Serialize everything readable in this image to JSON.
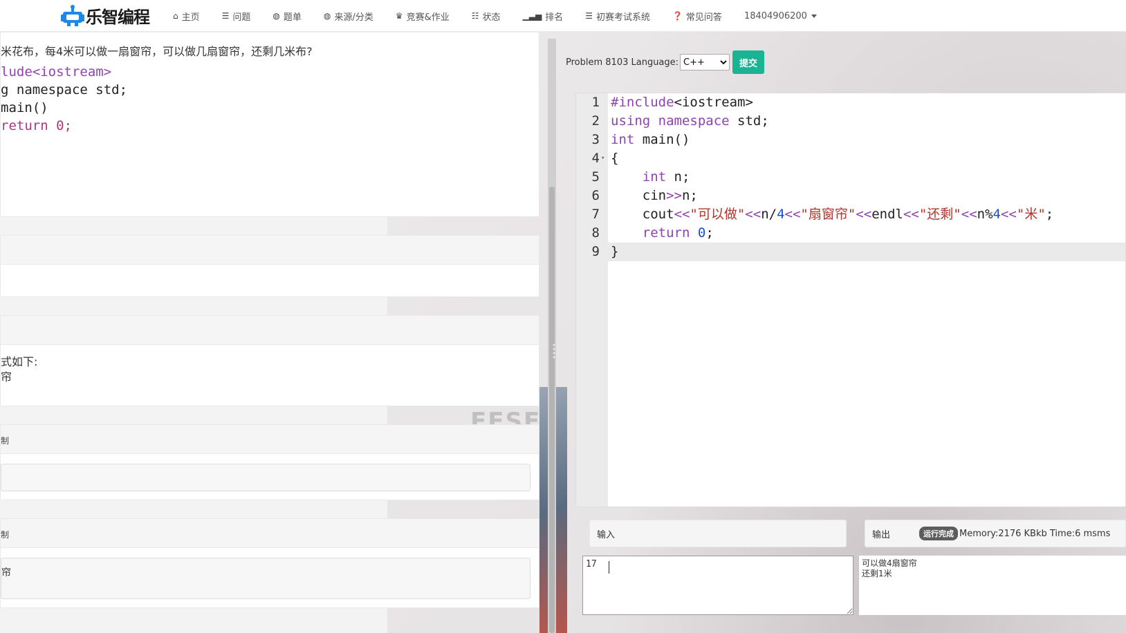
{
  "brand": {
    "name": "乐智编程",
    "logo_icon": "robot-logo-icon"
  },
  "nav": {
    "items": [
      {
        "label": "主页",
        "icon": "home-icon"
      },
      {
        "label": "问题",
        "icon": "list-icon"
      },
      {
        "label": "题单",
        "icon": "globe-icon"
      },
      {
        "label": "来源/分类",
        "icon": "globe-icon"
      },
      {
        "label": "竞赛&作业",
        "icon": "trophy-icon"
      },
      {
        "label": "状态",
        "icon": "list-icon"
      },
      {
        "label": "排名",
        "icon": "signal-icon"
      },
      {
        "label": "初赛考试系统",
        "icon": "list-icon"
      },
      {
        "label": "常见问答",
        "icon": "question-icon"
      }
    ],
    "user": "18404906200"
  },
  "left": {
    "description": "米花布，每4米可以做一扇窗帘，可以做几扇窗帘，还剩几米布?",
    "code_lines": [
      "lude<iostream>",
      "g namespace std;",
      "main()",
      "",
      "",
      "return 0;"
    ],
    "sample_output_lines": [
      "式如下:",
      "帘"
    ],
    "copy_label_1": "制",
    "copy_label_2": "制",
    "sample_box_text": "帘"
  },
  "toolbar": {
    "problem_label": "Problem 8103 Language:",
    "language": "C++",
    "language_options": [
      "C++"
    ],
    "submit_label": "提交"
  },
  "editor": {
    "line_numbers": [
      "1",
      "2",
      "3",
      "4",
      "5",
      "6",
      "7",
      "8",
      "9"
    ],
    "lines": [
      "#include<iostream>",
      "using namespace std;",
      "int main()",
      "{",
      "    int n;",
      "    cin>>n;",
      "    cout<<\"可以做\"<<n/4<<\"扇窗帘\"<<endl<<\"还剩\"<<n%4<<\"米\";",
      "    return 0;",
      "}"
    ],
    "active_line": 9
  },
  "io": {
    "input_label": "输入",
    "output_label": "输出",
    "status_badge": "运行完成",
    "stats": "Memory:2176 KBkb  Time:6 msms",
    "input_value": "17",
    "output_lines": [
      "可以做4扇窗帘",
      "还剩1米"
    ]
  },
  "colors": {
    "submit": "#1ab394",
    "keyword": "#8e44ad",
    "string": "#b4322b",
    "number": "#1a4fd1"
  }
}
